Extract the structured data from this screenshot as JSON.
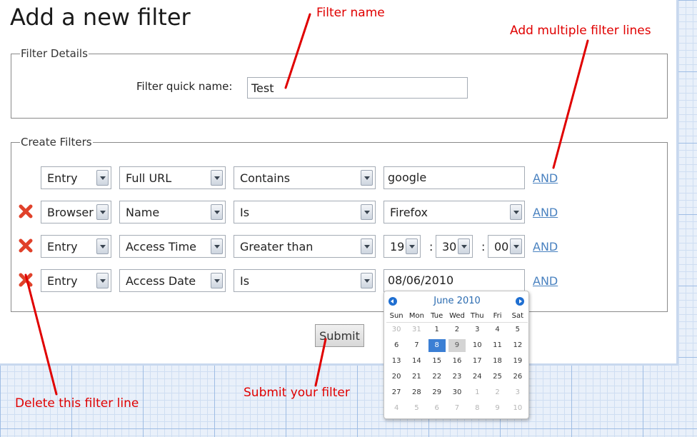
{
  "page_title": "Add a new filter",
  "filter_details": {
    "legend": "Filter Details",
    "quick_name_label": "Filter quick name:",
    "quick_name_value": "Test"
  },
  "create_filters": {
    "legend": "Create Filters",
    "rows": [
      {
        "type": "Entry",
        "field": "Full URL",
        "operator": "Contains",
        "value": "google",
        "and_label": "AND",
        "deletable": false
      },
      {
        "type": "Browser",
        "field": "Name",
        "operator": "Is",
        "value": "Firefox",
        "and_label": "AND",
        "deletable": true
      },
      {
        "type": "Entry",
        "field": "Access Time",
        "operator": "Greater than",
        "time": {
          "hour": "19",
          "minute": "30",
          "second": "00"
        },
        "and_label": "AND",
        "deletable": true
      },
      {
        "type": "Entry",
        "field": "Access Date",
        "operator": "Is",
        "value": "08/06/2010",
        "and_label": "AND",
        "deletable": true
      }
    ],
    "time_separator": ":"
  },
  "submit_label": "Submit",
  "calendar": {
    "month_label": "June 2010",
    "weekdays": [
      "Sun",
      "Mon",
      "Tue",
      "Wed",
      "Thu",
      "Fri",
      "Sat"
    ],
    "weeks": [
      [
        "30",
        "31",
        "1",
        "2",
        "3",
        "4",
        "5"
      ],
      [
        "6",
        "7",
        "8",
        "9",
        "10",
        "11",
        "12"
      ],
      [
        "13",
        "14",
        "15",
        "16",
        "17",
        "18",
        "19"
      ],
      [
        "20",
        "21",
        "22",
        "23",
        "24",
        "25",
        "26"
      ],
      [
        "27",
        "28",
        "29",
        "30",
        "1",
        "2",
        "3"
      ],
      [
        "4",
        "5",
        "6",
        "7",
        "8",
        "9",
        "10"
      ]
    ],
    "selected_day": "8",
    "highlighted_day": "9"
  },
  "annotations": {
    "filter_name": "Filter name",
    "add_lines": "Add multiple filter lines",
    "delete_line": "Delete this filter line",
    "submit": "Submit your filter"
  },
  "colors": {
    "annotation": "#e00000",
    "link": "#4a82c0",
    "delete_icon": "#e0412a",
    "calendar_selected": "#3b7fd4"
  }
}
